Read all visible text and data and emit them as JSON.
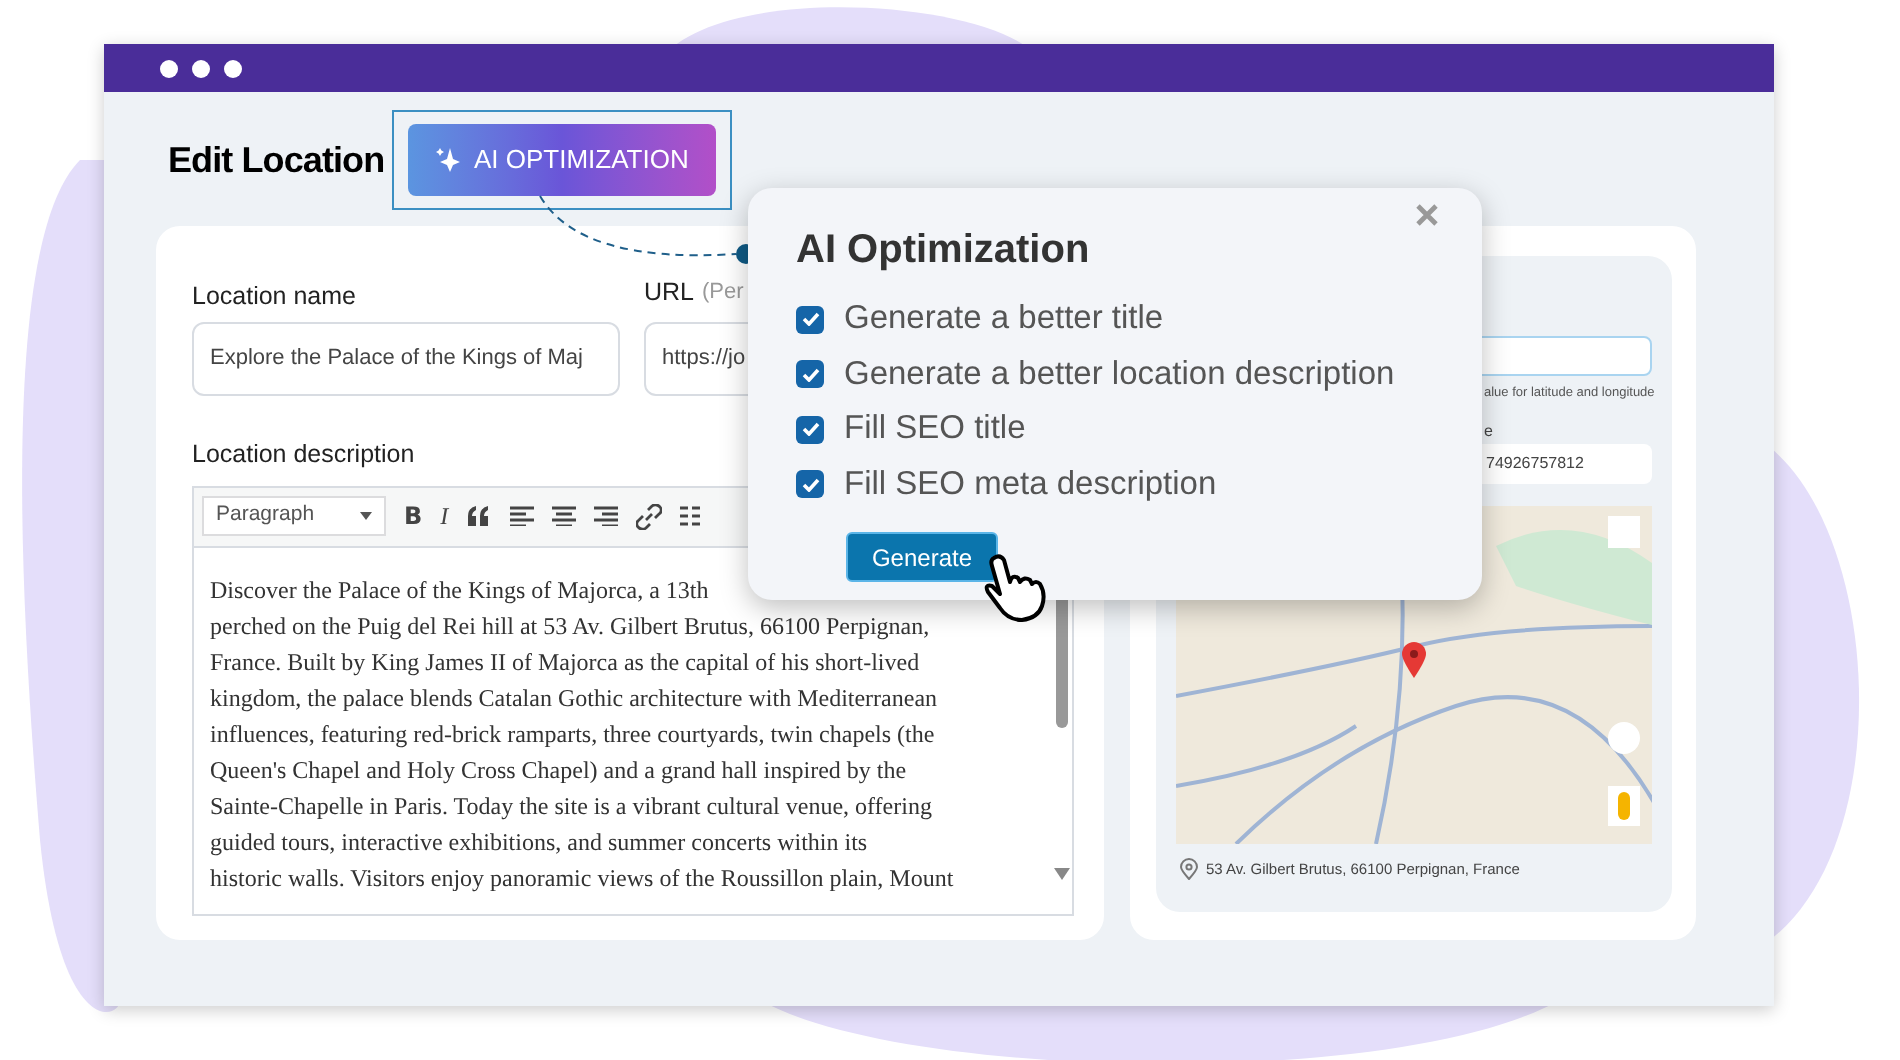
{
  "window": {
    "title": "Edit Location",
    "ai_button": "AI OPTIMIZATION"
  },
  "form": {
    "location_name": {
      "label": "Location name",
      "value": "Explore the Palace of the Kings of Maj"
    },
    "url": {
      "label": "URL",
      "hint": "(Per",
      "value": "https://jo"
    }
  },
  "description": {
    "label": "Location description",
    "format": "Paragraph",
    "toolbar_letters": [
      {
        "kind": "bold",
        "label": "B"
      },
      {
        "kind": "italic",
        "label": "I"
      }
    ],
    "lines": [
      "Discover the Palace of the Kings of Majorca, a 13th",
      "perched on the Puig del Rei hill at 53 Av. Gilbert Brutus, 66100 Perpignan,",
      "France. Built by King James II of Majorca as the capital of his short-lived",
      "kingdom, the palace blends Catalan Gothic architecture with Mediterranean",
      "influences, featuring red-brick ramparts, three courtyards, twin chapels (the",
      "Queen's Chapel and Holy Cross Chapel) and a grand hall inspired by the",
      "Sainte-Chapelle in Paris. Today the site is a vibrant cultural venue, offering",
      "guided tours, interactive exhibitions, and summer concerts within its",
      "historic walls. Visitors enjoy panoramic views of the Roussillon plain, Mount"
    ]
  },
  "location_panel": {
    "hint": "alue for latitude and longitude",
    "field_label": "e",
    "field_value": "74926757812",
    "address": "53 Av. Gilbert Brutus, 66100 Perpignan, France"
  },
  "popup": {
    "title": "AI Optimization",
    "options": [
      {
        "label": "Generate a better title",
        "checked": true
      },
      {
        "label": "Generate a better location description",
        "checked": true
      },
      {
        "label": "Fill SEO title",
        "checked": true
      },
      {
        "label": "Fill SEO meta description",
        "checked": true
      }
    ],
    "button": "Generate"
  }
}
